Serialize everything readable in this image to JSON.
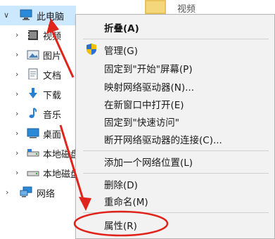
{
  "nav": {
    "this_pc": "此电脑",
    "items": [
      {
        "label": "视频",
        "icon": "video-icon"
      },
      {
        "label": "图片",
        "icon": "pictures-icon"
      },
      {
        "label": "文档",
        "icon": "documents-icon"
      },
      {
        "label": "下载",
        "icon": "download-icon"
      },
      {
        "label": "音乐",
        "icon": "music-icon"
      },
      {
        "label": "桌面",
        "icon": "desktop-icon"
      },
      {
        "label": "本地磁盘",
        "icon": "drive-icon"
      },
      {
        "label": "本地磁盘",
        "icon": "drive-icon"
      }
    ],
    "network": "网络"
  },
  "content": {
    "folder_partial_text": "视频"
  },
  "menu": {
    "collapse": "折叠(A)",
    "manage": "管理(G)",
    "pin_start": "固定到\"开始\"屏幕(P)",
    "map_drive": "映射网络驱动器(N)...",
    "open_new_window": "在新窗口中打开(E)",
    "pin_quick": "固定到\"快速访问\"",
    "disconnect": "断开网络驱动器的连接(C)...",
    "add_network": "添加一个网络位置(L)",
    "delete": "删除(D)",
    "rename": "重命名(M)",
    "properties": "属性(R)"
  },
  "colors": {
    "annotation": "#e0241b",
    "selection": "#cce8ff",
    "menu_bg": "#f2f2f2"
  }
}
